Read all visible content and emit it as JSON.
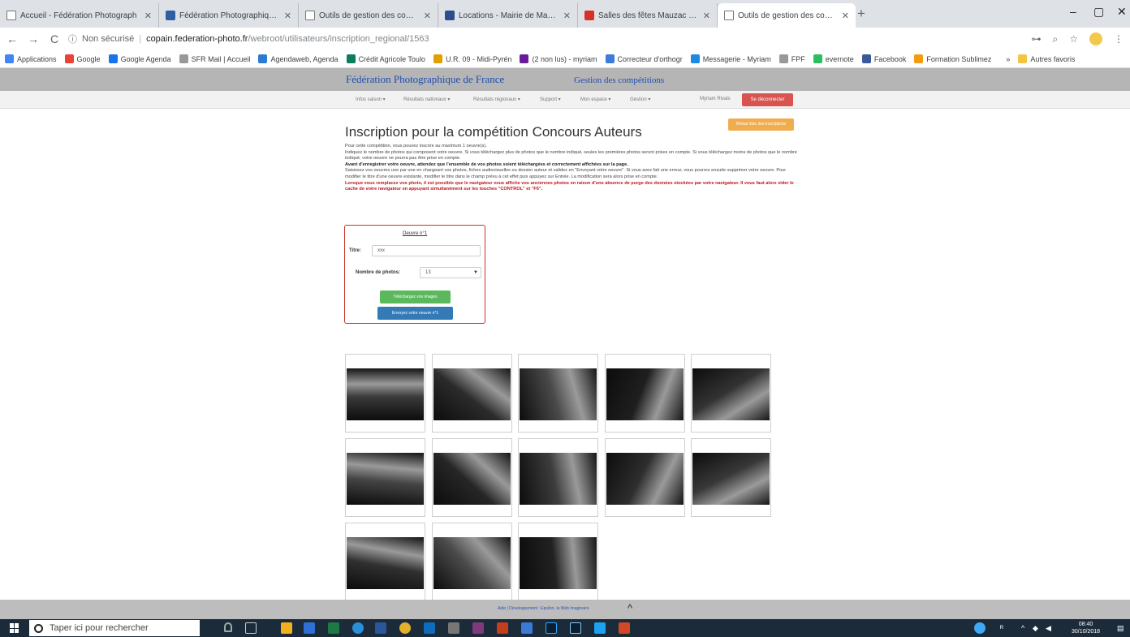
{
  "browser": {
    "tabs": [
      {
        "label": "Accueil - Fédération Photograph",
        "favicon": "doc-icon",
        "active": false
      },
      {
        "label": "Fédération Photographique de F",
        "favicon": "fpf-icon",
        "active": false
      },
      {
        "label": "Outils de gestion des concours",
        "favicon": "doc-icon",
        "active": false
      },
      {
        "label": "Locations - Mairie de Mauzac",
        "favicon": "mairie-icon",
        "active": false
      },
      {
        "label": "Salles des fêtes Mauzac (31410)",
        "favicon": "red-icon",
        "active": false
      },
      {
        "label": "Outils de gestion des concours",
        "favicon": "doc-icon",
        "active": true
      }
    ],
    "new_tab": "+",
    "window_controls": {
      "minimize": "–",
      "maximize": "▢",
      "close": "✕"
    },
    "nav": {
      "back": "←",
      "forward": "→",
      "reload": "C"
    },
    "address": {
      "security": "Non sécurisé",
      "host": "copain.federation-photo.fr",
      "path": "/webroot/utilisateurs/inscription_regional/1563"
    },
    "bookmarks": [
      {
        "label": "Applications",
        "color": "#4285f4"
      },
      {
        "label": "Google",
        "color": "#ea4335"
      },
      {
        "label": "Google Agenda",
        "color": "#1a73e8"
      },
      {
        "label": "SFR Mail | Accueil",
        "color": "#999999"
      },
      {
        "label": "Agendaweb, Agenda",
        "color": "#2c7bd1"
      },
      {
        "label": "Crédit Agricole Toulo",
        "color": "#0d7b5e"
      },
      {
        "label": "U.R. 09 - Midi-Pyrén",
        "color": "#e0a100"
      },
      {
        "label": "(2 non lus) - myriam",
        "color": "#6a1b9a"
      },
      {
        "label": "Correcteur d'orthogr",
        "color": "#3d7bd9"
      },
      {
        "label": "Messagerie - Myriam",
        "color": "#1e88e5"
      },
      {
        "label": "FPF",
        "color": "#999999"
      },
      {
        "label": "evernote",
        "color": "#2dbe60"
      },
      {
        "label": "Facebook",
        "color": "#3b5998"
      },
      {
        "label": "Formation Sublimez",
        "color": "#f39c12"
      },
      {
        "label": "Autres favoris",
        "color": "#f4c542"
      }
    ],
    "bookmarks_more": "»"
  },
  "site": {
    "title": "Fédération Photographique de France",
    "subtitle": "Gestion des compétitions",
    "nav_items": [
      "Infos saison ▾",
      "Résultats nationaux ▾",
      "Résultats régionaux ▾",
      "Support ▾",
      "Mon espace ▾",
      "Gestion ▾"
    ],
    "user_name": "Myriam Rivals",
    "logout_label": "Se déconnecter",
    "back_label": "Retour liste des inscriptions"
  },
  "main": {
    "heading": "Inscription pour la compétition Concours Auteurs",
    "intro_1": "Pour cette compétition, vous pouvez inscrire au maximum 1 oeuvre(s).",
    "intro_2": "Indiquez le nombre de photos qui composent votre oeuvre. Si vous téléchargez plus de photos que le nombre indiqué, seules les premières photos seront prises en compte. Si vous téléchargez moins de photos que le nombre indiqué, votre oeuvre ne pourra pas être prise en compte.",
    "intro_bold": "Avant d'enregistrer votre oeuvre, attendez que l'ensemble de vos photos soient téléchargées et correctement affichées sur la page.",
    "intro_3": "Saisissez vos oeuvres une par une en chargeant vos photos, fiches audiovisuelles ou dossier auteur et validez en \"Envoyant votre oeuvre\". Si vous avez fait une erreur, vous pourrez ensuite supprimer votre oeuvre. Pour modifier le titre d'une oeuvre existante, modifier le titre dans le champ prévu à cet effet puis appuyez sur Entrée. La modification sera alors prise en compte.",
    "intro_red": "Lorsque vous remplacez vos photo, il est possible que le navigateur vous affiche vos anciennes photos en raison d'une absence de purge des données stockées par votre navigateur. Il vous faut alors vider le cache de votre navigateur en appuyant simultanément sur les touches \"CONTROL\" et \"F5\"."
  },
  "oeuvre": {
    "title": "Oeuvre n°1",
    "titre_label": "Titre:",
    "titre_value": "xxx",
    "photos_label": "Nombre de photos:",
    "photos_value": "13",
    "upload_label": "Téléchargez vos images",
    "send_label": "Envoyez votre oeuvre n°1"
  },
  "photos": {
    "count": 13
  },
  "footer": {
    "links": "Aide  |  Développement : Epsilon, la Web Imaginaire",
    "caret": "^"
  },
  "taskbar": {
    "search_placeholder": "Taper ici pour rechercher",
    "time": "08:40",
    "date": "30/10/2018"
  }
}
